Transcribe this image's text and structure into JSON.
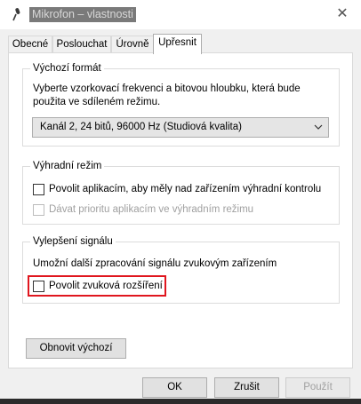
{
  "window": {
    "title": "Mikrofon – vlastnosti",
    "close_glyph": "✕"
  },
  "tabs": [
    {
      "label": "Obecné",
      "active": false
    },
    {
      "label": "Poslouchat",
      "active": false
    },
    {
      "label": "Úrovně",
      "active": false
    },
    {
      "label": "Upřesnit",
      "active": true
    }
  ],
  "default_format": {
    "title": "Výchozí formát",
    "description_line1": "Vyberte vzorkovací frekvenci a bitovou hloubku, která bude",
    "description_line2": "použita ve sdíleném režimu.",
    "selected": "Kanál 2, 24 bitů, 96000 Hz (Studiová kvalita)"
  },
  "exclusive_mode": {
    "title": "Výhradní režim",
    "allow_exclusive": {
      "label": "Povolit aplikacím, aby měly nad zařízením výhradní kontrolu",
      "checked": false
    },
    "priority": {
      "label": "Dávat prioritu aplikacím ve výhradním režimu",
      "checked": false,
      "disabled": true
    }
  },
  "signal_enhancements": {
    "title": "Vylepšení signálu",
    "description": "Umožní další zpracování signálu zvukovým zařízením",
    "enable": {
      "label": "Povolit zvuková rozšíření",
      "checked": false
    },
    "highlight_color": "#e0161e"
  },
  "buttons": {
    "restore_defaults": "Obnovit výchozí",
    "ok": "OK",
    "cancel": "Zrušit",
    "apply": "Použít"
  },
  "icons": {
    "window_icon": "microphone-icon",
    "dropdown": "chevron-down-icon"
  }
}
